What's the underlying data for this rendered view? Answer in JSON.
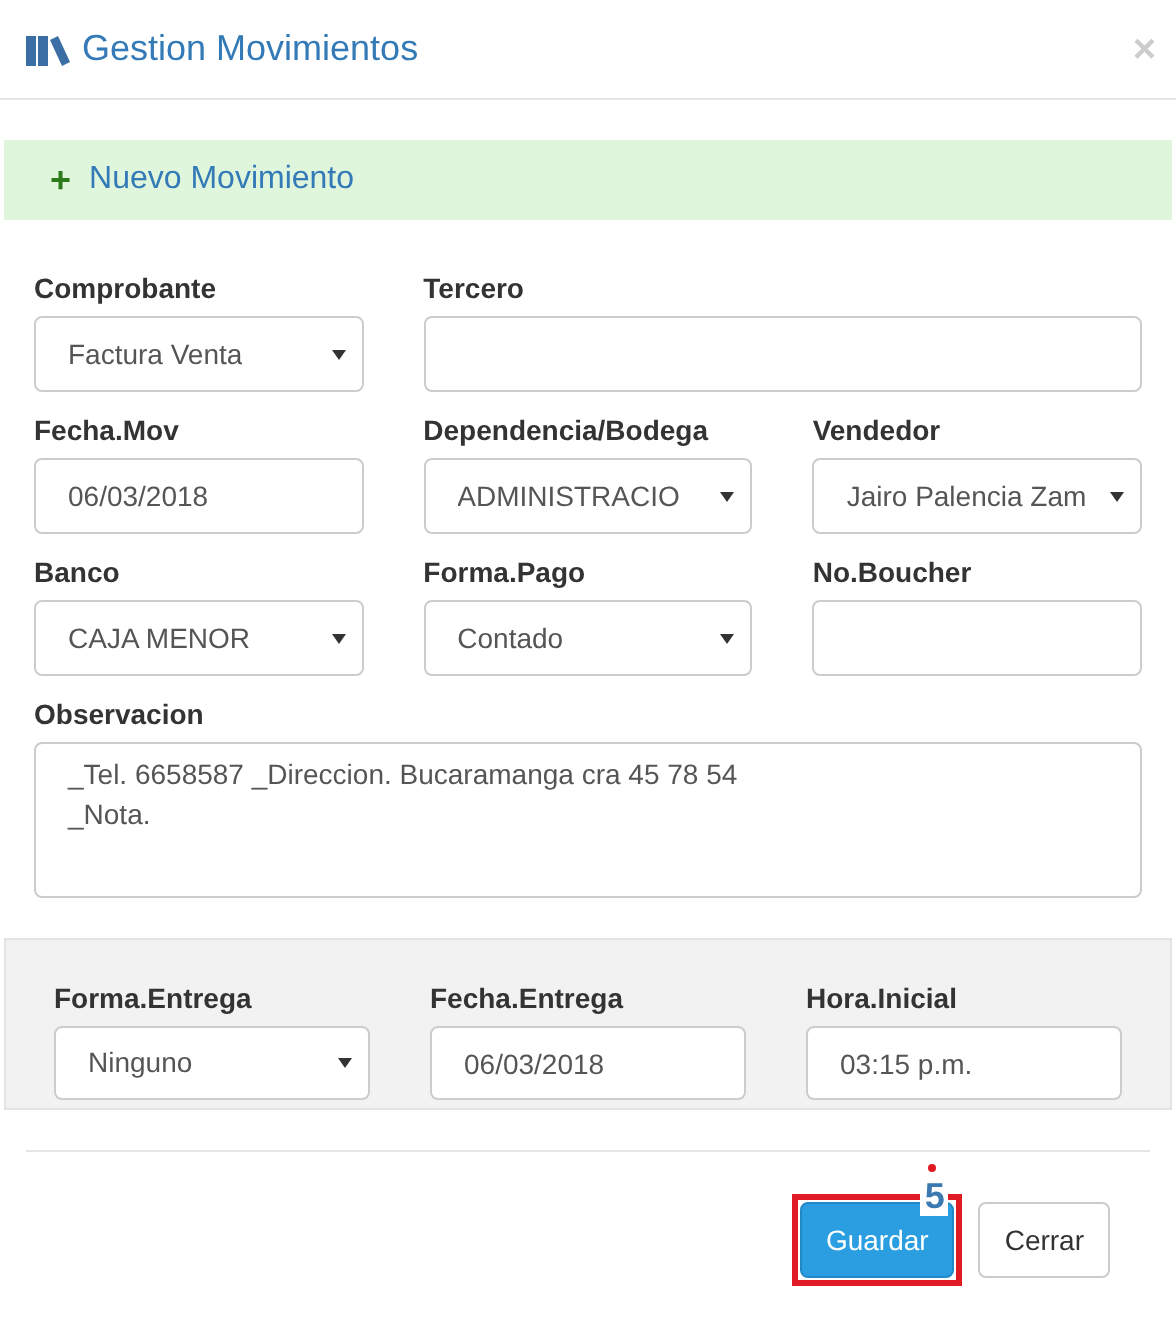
{
  "window": {
    "title": "Gestion Movimientos",
    "close": "×"
  },
  "section": {
    "icon": "+",
    "title": "Nuevo Movimiento"
  },
  "fields": [
    {
      "label": "Comprobante",
      "kind": "select",
      "value": "Factura Venta"
    },
    {
      "label": "Tercero",
      "kind": "text"
    },
    {
      "label": "Fecha.Mov",
      "kind": "text",
      "value": "06/03/2018"
    },
    {
      "label": "Dependencia/Bodega",
      "kind": "select",
      "value": "ADMINISTRACIO"
    },
    {
      "label": "Vendedor",
      "kind": "select",
      "value": "Jairo Palencia Zam"
    },
    {
      "label": "Banco",
      "kind": "select",
      "value": "CAJA MENOR"
    },
    {
      "label": "Forma.Pago",
      "kind": "select",
      "value": "Contado"
    },
    {
      "label": "No.Boucher",
      "kind": "text"
    }
  ],
  "observacion": {
    "label": "Observacion",
    "value": "_Tel. 6658587 _Direccion. Bucaramanga cra 45 78 54\n_Nota."
  },
  "delivery_fields": [
    {
      "label": "Forma.Entrega",
      "kind": "select",
      "value": "Ninguno"
    },
    {
      "label": "Fecha.Entrega",
      "kind": "text",
      "value": "06/03/2018"
    },
    {
      "label": "Hora.Inicial",
      "kind": "text",
      "value": "03:15 p.m."
    }
  ],
  "buttons": [
    {
      "label": "Guardar",
      "kind": "primary",
      "highlighted": true,
      "marker": "5"
    },
    {
      "label": "Cerrar",
      "kind": "default",
      "highlighted": false
    }
  ]
}
